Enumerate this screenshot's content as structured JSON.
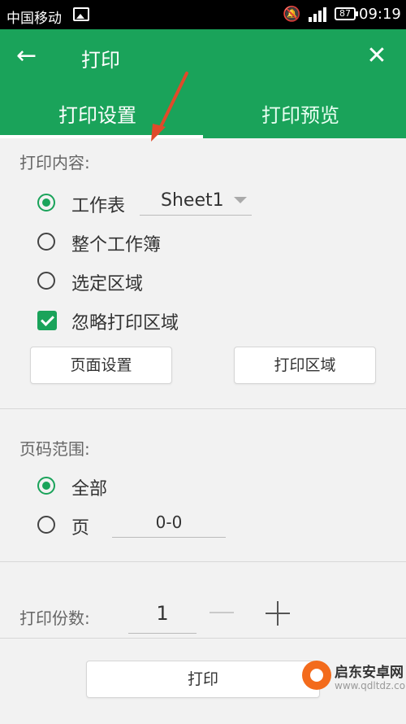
{
  "status_bar": {
    "carrier": "中国移动",
    "battery": "87",
    "time": "09:19"
  },
  "app_bar": {
    "title": "打印",
    "tabs": [
      {
        "label": "打印设置",
        "active": true
      },
      {
        "label": "打印预览",
        "active": false
      }
    ]
  },
  "print_content": {
    "label": "打印内容:",
    "options": [
      {
        "label": "工作表",
        "checked": true
      },
      {
        "label": "整个工作簿",
        "checked": false
      },
      {
        "label": "选定区域",
        "checked": false
      }
    ],
    "sheet_value": "Sheet1",
    "ignore_print_area": {
      "label": "忽略打印区域",
      "checked": true
    },
    "buttons": {
      "page_setup": "页面设置",
      "print_area": "打印区域"
    }
  },
  "page_range": {
    "label": "页码范围:",
    "options": [
      {
        "label": "全部",
        "checked": true
      },
      {
        "label": "页",
        "checked": false
      }
    ],
    "range_value": "0-0"
  },
  "copies": {
    "label": "打印份数:",
    "value": "1"
  },
  "print_button": "打印",
  "watermark": {
    "name": "启东安卓网",
    "url": "www.qdltdz.com"
  },
  "colors": {
    "primary_green": "#1aa35a",
    "arrow_red": "#e04a2a"
  }
}
